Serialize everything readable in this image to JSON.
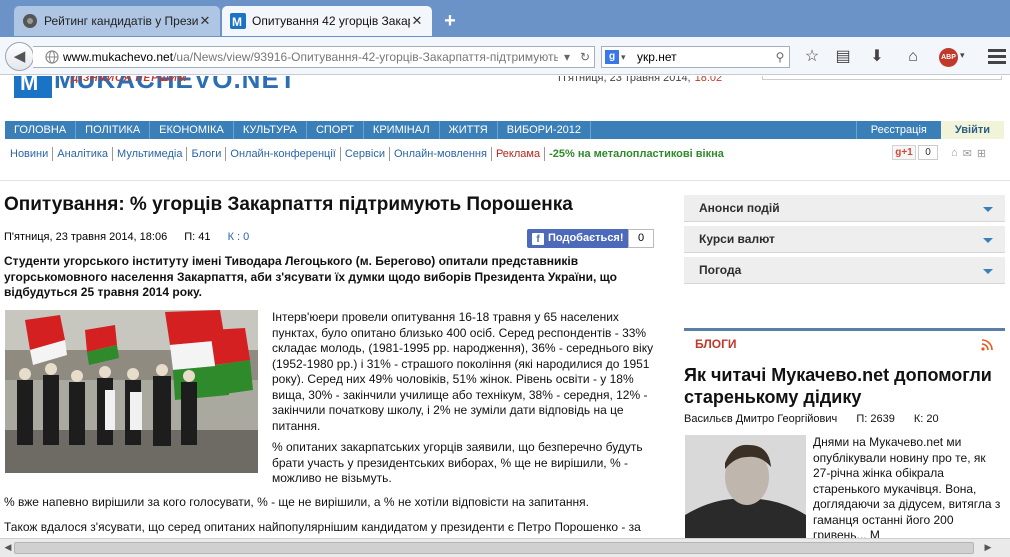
{
  "browser": {
    "tabs": [
      {
        "title": "Рейтинг кандидатів у Прези..."
      },
      {
        "title": "Опитування 42 угорців Закар..."
      }
    ],
    "url": {
      "host": "www.mukachevo.net",
      "path": "/ua/News/view/93916-Опитування-42-угорців-Закарпаття-підтримують-Порош"
    },
    "search": {
      "value": "укр.нет",
      "engine": "g"
    },
    "abp_label": "ABP"
  },
  "site": {
    "brand": "MUKACHEVO.NET",
    "slogan": "ДІЗНАЙСЯ ПЕРШИМ",
    "date": "П'ятниця, 23 травня 2014,",
    "time": "18:02",
    "menu": [
      "Головна",
      "Політика",
      "Економіка",
      "Культура",
      "Спорт",
      "Кримінал",
      "Життя",
      "Вибори-2012"
    ],
    "register": "Реєстрація",
    "login": "Увійти",
    "submenu": [
      "Новини",
      "Аналітика",
      "Мультимедіа",
      "Блоги",
      "Онлайн-конференції",
      "Сервіси",
      "Онлайн-мовлення"
    ],
    "ad_label": "Реклама",
    "promo": "-25% на металопластикові вікна",
    "gplus": "g+1",
    "gplus_count": "0"
  },
  "article": {
    "title": "Опитування:      % угорців Закарпаття підтримують Порошенка",
    "date": "П'ятниця, 23 травня 2014, 18:06",
    "views": "П: 41",
    "comments": "К : 0",
    "fb_label": "Подобається!",
    "fb_count": "0",
    "lead": "Студенти угорського інституту імені Тиводара Легоцького (м. Берегово) опитали представників угорськомовного населення Закарпаття, аби з'ясувати їх думки щодо виборів Президента України, що відбудуться 25 травня 2014 року.",
    "p1": "Інтерв'юери провели опитування 16-18 травня у 65 населених пунктах, було опитано близько 400 осіб. Серед респондентів - 33% складає молодь, (1981-1995 рр. народження), 36% - середнього віку (1952-1980 рр.) і 31% - страшого покоління (які народилися до  1951 року). Серед них 49% чоловіків, 51% жінок. Рівень освіти - у 18% вища, 30% - закінчили училище або технікум, 38% - середня, 12% - закінчили початкову школу, і 2% не зуміли дати відповідь на це питання.",
    "p2": "    % опитаних закарпатських угорців заявили, що безперечно будуть брати участь у президентських виборах,     % ще не вирішили,     % - можливо не візьмуть.",
    "p3": "    % вже напевно вирішили за кого голосувати,     % - ще не вирішили, а     % не хотіли відповісти на запитання.",
    "p4": "Також вдалося з'ясувати, що серед опитаних найпопулярнішим кандидатом у президенти є Петро Порошенко - за"
  },
  "sidebar": {
    "accordion": [
      "Анонси подій",
      "Курси валют",
      "Погода"
    ],
    "blogs_label": "БЛОГИ",
    "blog_title": "Як читачі Мукачево.net допомогли старенькому дідику",
    "blog_author": "Васильєв Дмитро Георгійович",
    "blog_views": "П: 2639",
    "blog_comments": "К:  20",
    "blog_text": "Днями на Мукачево.net ми опублікували новину про те, як 27-річна жінка обікрала старенького мукачівця. Вона, доглядаючи за дідусем, витягла з гаманця останні його 200 гривень... М"
  }
}
